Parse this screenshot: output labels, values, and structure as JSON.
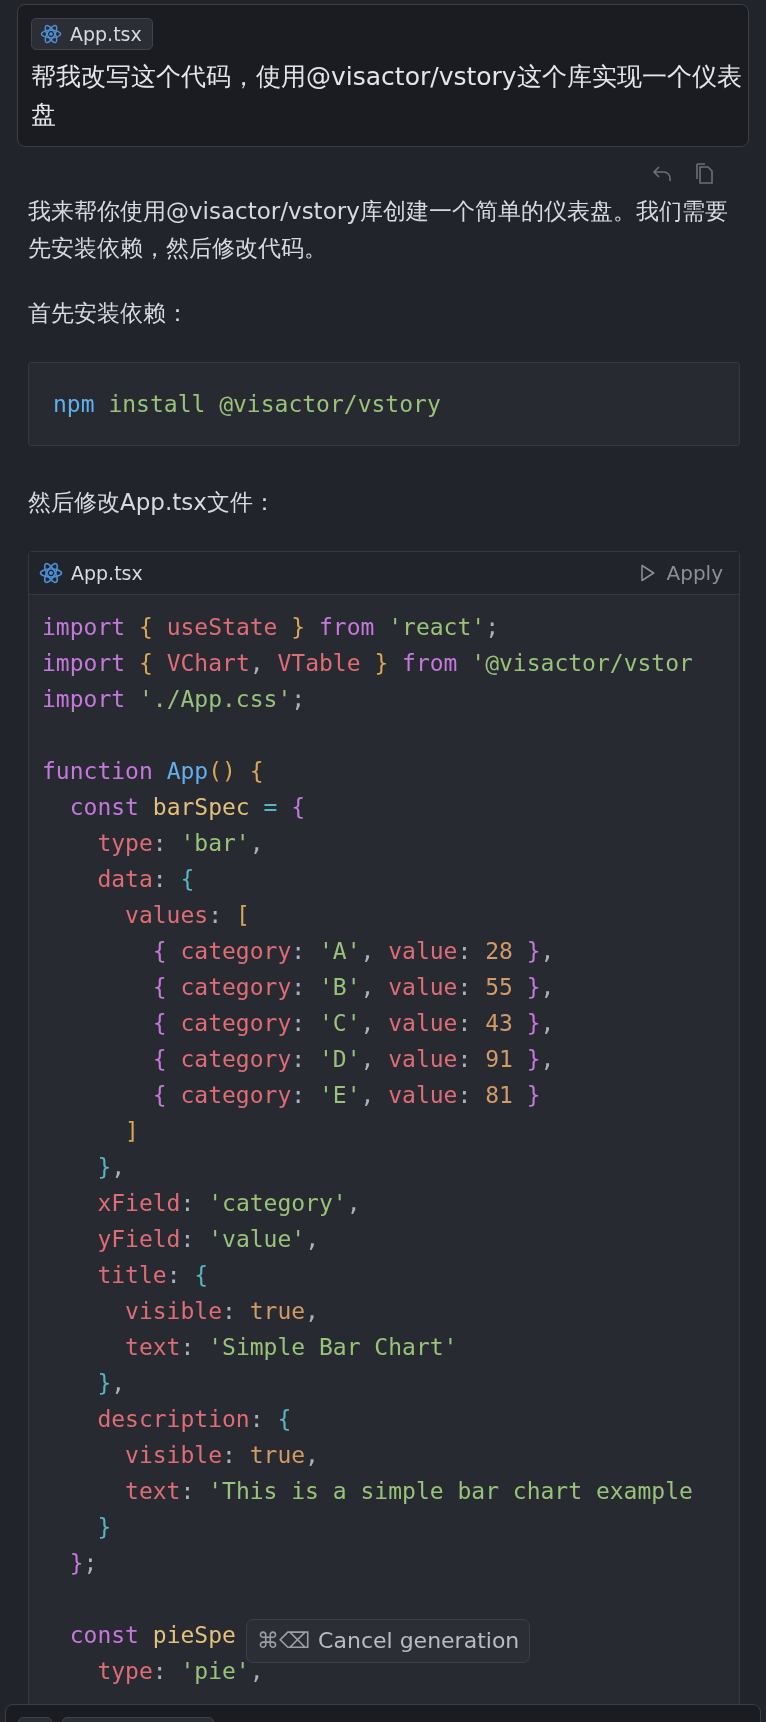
{
  "user_message": {
    "attachment": "App.tsx",
    "text": "帮我改写这个代码，使用@visactor/vstory这个库实现一个仪表盘"
  },
  "reply": [
    {
      "kind": "paragraph",
      "text": "我来帮你使用@visactor/vstory库创建一个简单的仪表盘。我们需要先安装依赖，然后修改代码。"
    },
    {
      "kind": "paragraph",
      "text": "首先安装依赖："
    },
    {
      "kind": "terminal",
      "tokens": [
        {
          "text": "npm",
          "kind": "function"
        },
        {
          "text": " install @visactor/vstory",
          "kind": "string"
        }
      ]
    },
    {
      "kind": "paragraph",
      "text": "然后修改App.tsx文件："
    },
    {
      "kind": "code_file",
      "filename": "App.tsx",
      "action": "Apply",
      "lines": [
        {
          "tokens": [
            {
              "text": "import",
              "kind": "keyword"
            },
            {
              "text": " {",
              "kind": "bracket1"
            },
            {
              "text": " useState ",
              "kind": "variable"
            },
            {
              "text": "}",
              "kind": "bracket1"
            },
            {
              "text": " from ",
              "kind": "keyword"
            },
            {
              "text": "'react'",
              "kind": "string"
            },
            {
              "text": ";",
              "kind": "plain"
            }
          ]
        },
        {
          "tokens": [
            {
              "text": "import",
              "kind": "keyword"
            },
            {
              "text": " {",
              "kind": "bracket1"
            },
            {
              "text": " VChart",
              "kind": "variable"
            },
            {
              "text": ", ",
              "kind": "plain"
            },
            {
              "text": "VTable ",
              "kind": "variable"
            },
            {
              "text": "}",
              "kind": "bracket1"
            },
            {
              "text": " from ",
              "kind": "keyword"
            },
            {
              "text": "'@visactor/vstor",
              "kind": "string"
            }
          ]
        },
        {
          "tokens": [
            {
              "text": "import",
              "kind": "keyword"
            },
            {
              "text": " './App.css'",
              "kind": "string"
            },
            {
              "text": ";",
              "kind": "plain"
            }
          ]
        },
        {
          "blank_before": true,
          "tokens": [
            {
              "text": "function",
              "kind": "keyword"
            },
            {
              "text": " App",
              "kind": "function"
            },
            {
              "text": "() {",
              "kind": "bracket1"
            }
          ]
        },
        {
          "tokens": [
            {
              "text": "  const",
              "kind": "keyword"
            },
            {
              "text": " barSpec",
              "kind": "name"
            },
            {
              "text": " =",
              "kind": "operator"
            },
            {
              "text": " {",
              "kind": "bracket2"
            }
          ]
        },
        {
          "tokens": [
            {
              "text": "    type",
              "kind": "variable"
            },
            {
              "text": ": ",
              "kind": "plain"
            },
            {
              "text": "'bar'",
              "kind": "string"
            },
            {
              "text": ",",
              "kind": "plain"
            }
          ]
        },
        {
          "tokens": [
            {
              "text": "    data",
              "kind": "variable"
            },
            {
              "text": ": ",
              "kind": "plain"
            },
            {
              "text": "{",
              "kind": "bracket3"
            }
          ]
        },
        {
          "tokens": [
            {
              "text": "      values",
              "kind": "variable"
            },
            {
              "text": ": ",
              "kind": "plain"
            },
            {
              "text": "[",
              "kind": "bracket1"
            }
          ]
        },
        {
          "tokens": [
            {
              "text": "        {",
              "kind": "bracket2"
            },
            {
              "text": " category",
              "kind": "variable"
            },
            {
              "text": ": ",
              "kind": "plain"
            },
            {
              "text": "'A'",
              "kind": "string"
            },
            {
              "text": ", ",
              "kind": "plain"
            },
            {
              "text": "value",
              "kind": "variable"
            },
            {
              "text": ": ",
              "kind": "plain"
            },
            {
              "text": "28",
              "kind": "number"
            },
            {
              "text": " }",
              "kind": "bracket2"
            },
            {
              "text": ",",
              "kind": "plain"
            }
          ]
        },
        {
          "tokens": [
            {
              "text": "        {",
              "kind": "bracket2"
            },
            {
              "text": " category",
              "kind": "variable"
            },
            {
              "text": ": ",
              "kind": "plain"
            },
            {
              "text": "'B'",
              "kind": "string"
            },
            {
              "text": ", ",
              "kind": "plain"
            },
            {
              "text": "value",
              "kind": "variable"
            },
            {
              "text": ": ",
              "kind": "plain"
            },
            {
              "text": "55",
              "kind": "number"
            },
            {
              "text": " }",
              "kind": "bracket2"
            },
            {
              "text": ",",
              "kind": "plain"
            }
          ]
        },
        {
          "tokens": [
            {
              "text": "        {",
              "kind": "bracket2"
            },
            {
              "text": " category",
              "kind": "variable"
            },
            {
              "text": ": ",
              "kind": "plain"
            },
            {
              "text": "'C'",
              "kind": "string"
            },
            {
              "text": ", ",
              "kind": "plain"
            },
            {
              "text": "value",
              "kind": "variable"
            },
            {
              "text": ": ",
              "kind": "plain"
            },
            {
              "text": "43",
              "kind": "number"
            },
            {
              "text": " }",
              "kind": "bracket2"
            },
            {
              "text": ",",
              "kind": "plain"
            }
          ]
        },
        {
          "tokens": [
            {
              "text": "        {",
              "kind": "bracket2"
            },
            {
              "text": " category",
              "kind": "variable"
            },
            {
              "text": ": ",
              "kind": "plain"
            },
            {
              "text": "'D'",
              "kind": "string"
            },
            {
              "text": ", ",
              "kind": "plain"
            },
            {
              "text": "value",
              "kind": "variable"
            },
            {
              "text": ": ",
              "kind": "plain"
            },
            {
              "text": "91",
              "kind": "number"
            },
            {
              "text": " }",
              "kind": "bracket2"
            },
            {
              "text": ",",
              "kind": "plain"
            }
          ]
        },
        {
          "tokens": [
            {
              "text": "        {",
              "kind": "bracket2"
            },
            {
              "text": " category",
              "kind": "variable"
            },
            {
              "text": ": ",
              "kind": "plain"
            },
            {
              "text": "'E'",
              "kind": "string"
            },
            {
              "text": ", ",
              "kind": "plain"
            },
            {
              "text": "value",
              "kind": "variable"
            },
            {
              "text": ": ",
              "kind": "plain"
            },
            {
              "text": "81",
              "kind": "number"
            },
            {
              "text": " }",
              "kind": "bracket2"
            }
          ]
        },
        {
          "tokens": [
            {
              "text": "      ]",
              "kind": "bracket1"
            }
          ]
        },
        {
          "tokens": [
            {
              "text": "    }",
              "kind": "bracket3"
            },
            {
              "text": ",",
              "kind": "plain"
            }
          ]
        },
        {
          "tokens": [
            {
              "text": "    xField",
              "kind": "variable"
            },
            {
              "text": ": ",
              "kind": "plain"
            },
            {
              "text": "'category'",
              "kind": "string"
            },
            {
              "text": ",",
              "kind": "plain"
            }
          ]
        },
        {
          "tokens": [
            {
              "text": "    yField",
              "kind": "variable"
            },
            {
              "text": ": ",
              "kind": "plain"
            },
            {
              "text": "'value'",
              "kind": "string"
            },
            {
              "text": ",",
              "kind": "plain"
            }
          ]
        },
        {
          "tokens": [
            {
              "text": "    title",
              "kind": "variable"
            },
            {
              "text": ": ",
              "kind": "plain"
            },
            {
              "text": "{",
              "kind": "bracket3"
            }
          ]
        },
        {
          "tokens": [
            {
              "text": "      visible",
              "kind": "variable"
            },
            {
              "text": ": ",
              "kind": "plain"
            },
            {
              "text": "true",
              "kind": "number"
            },
            {
              "text": ",",
              "kind": "plain"
            }
          ]
        },
        {
          "tokens": [
            {
              "text": "      text",
              "kind": "variable"
            },
            {
              "text": ": ",
              "kind": "plain"
            },
            {
              "text": "'Simple Bar Chart'",
              "kind": "string"
            }
          ]
        },
        {
          "tokens": [
            {
              "text": "    }",
              "kind": "bracket3"
            },
            {
              "text": ",",
              "kind": "plain"
            }
          ]
        },
        {
          "tokens": [
            {
              "text": "    description",
              "kind": "variable"
            },
            {
              "text": ": ",
              "kind": "plain"
            },
            {
              "text": "{",
              "kind": "bracket3"
            }
          ]
        },
        {
          "tokens": [
            {
              "text": "      visible",
              "kind": "variable"
            },
            {
              "text": ": ",
              "kind": "plain"
            },
            {
              "text": "true",
              "kind": "number"
            },
            {
              "text": ",",
              "kind": "plain"
            }
          ]
        },
        {
          "tokens": [
            {
              "text": "      text",
              "kind": "variable"
            },
            {
              "text": ": ",
              "kind": "plain"
            },
            {
              "text": "'This is a simple bar chart example",
              "kind": "string"
            }
          ]
        },
        {
          "tokens": [
            {
              "text": "    }",
              "kind": "bracket3"
            }
          ]
        },
        {
          "tokens": [
            {
              "text": "  }",
              "kind": "bracket2"
            },
            {
              "text": ";",
              "kind": "plain"
            }
          ]
        },
        {
          "blank_before": true,
          "tokens": [
            {
              "text": "  const",
              "kind": "keyword"
            },
            {
              "text": " pieSpe",
              "kind": "name"
            }
          ]
        },
        {
          "tokens": [
            {
              "text": "    type",
              "kind": "variable"
            },
            {
              "text": ": ",
              "kind": "plain"
            },
            {
              "text": "'pie'",
              "kind": "string"
            },
            {
              "text": ",",
              "kind": "plain"
            }
          ]
        }
      ]
    }
  ],
  "tooltip": {
    "shortcut": "⌘⌫",
    "label": "Cancel generation"
  }
}
